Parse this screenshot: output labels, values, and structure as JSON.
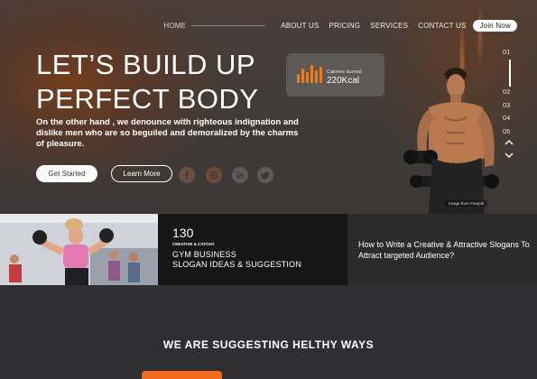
{
  "nav": {
    "items": [
      "HOME",
      "ABOUT US",
      "PRICING",
      "SERVICES",
      "CONTACT US"
    ],
    "join_label": "Join Now"
  },
  "hero": {
    "headline_line1": "LET’S BUILD UP",
    "headline_line2": "PERFECT BODY",
    "description": "On the other hand , we denounce with righteous  indignation and dislike men who are so beguiled and demoralized by the charms of pleasure.",
    "get_started": "Get Started",
    "learn_more": "Learn More",
    "social_icons": [
      "facebook-icon",
      "instagram-icon",
      "linkedin-icon",
      "twitter-icon"
    ],
    "image_caption": "Image from Freepik"
  },
  "calories": {
    "label": "Calories burned",
    "value": "220Kcal",
    "icon": "bar-chart-icon"
  },
  "pager": {
    "pages": [
      "01",
      "02",
      "03",
      "04",
      "05"
    ],
    "active": "01"
  },
  "features": {
    "count": "130",
    "tagline": "CREATIVE & CATCHY",
    "title_line1": "GYM BUSINESS",
    "title_line2": "SLOGAN IDEAS & SUGGESTION",
    "article": "How to Write a Creative & Attractive Slogans To Attract targeted Audience?"
  },
  "section": {
    "title": "WE ARE SUGGESTING HELTHY WAYS"
  },
  "colors": {
    "accent": "#f26a1b",
    "background": "#2f2f31",
    "panel_dark": "#161616"
  }
}
